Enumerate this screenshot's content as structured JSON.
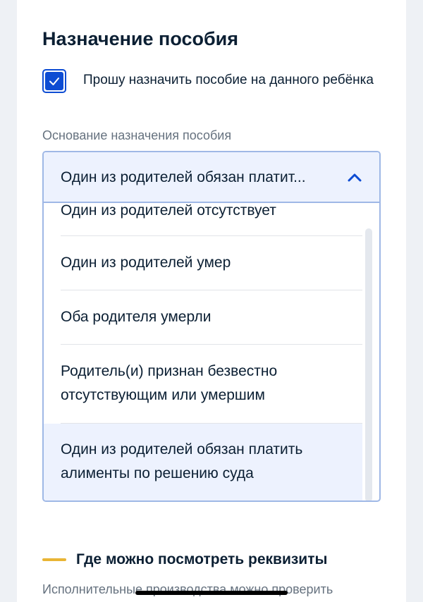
{
  "section": {
    "title": "Назначение пособия"
  },
  "checkbox": {
    "label": "Прошу назначить пособие на данного ребёнка",
    "checked": true
  },
  "basis": {
    "label": "Основание назначения пособия",
    "selected_value": "Один из родителей обязан платит...",
    "options": [
      "Один из родителей отсутствует",
      "Один из родителей умер",
      "Оба родителя умерли",
      "Родитель(и) признан безвестно отсутствующим или умершим",
      "Один из родителей обязан платить алименты по решению суда"
    ]
  },
  "requisites": {
    "title": "Где можно посмотреть реквизиты",
    "text": "Исполнительные производства можно проверить"
  },
  "colors": {
    "accent": "#0d4cd3",
    "selected_bg": "#edf2fe",
    "yellow_bar": "#e9b535",
    "muted_text": "#66727f"
  },
  "icons": {
    "check": "check-icon",
    "chevron": "chevron-up-icon"
  }
}
